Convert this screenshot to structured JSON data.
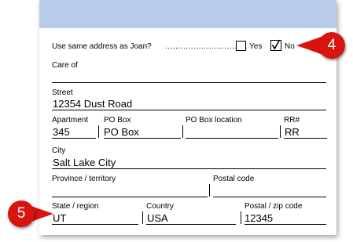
{
  "question": "Use same address as Joan?",
  "leader_dots": "................................",
  "options": {
    "yes_label": "Yes",
    "no_label": "No",
    "selected": "No"
  },
  "fields": {
    "care_of": {
      "label": "Care of",
      "value": ""
    },
    "street": {
      "label": "Street",
      "value": "12354 Dust Road"
    },
    "apartment": {
      "label": "Apartment",
      "value": "345"
    },
    "po_box": {
      "label": "PO Box",
      "value": "PO Box"
    },
    "po_box_location": {
      "label": "PO Box location",
      "value": ""
    },
    "rr": {
      "label": "RR#",
      "value": "RR"
    },
    "city": {
      "label": "City",
      "value": "Salt Lake City"
    },
    "province": {
      "label": "Province / territory",
      "value": ""
    },
    "postal_code": {
      "label": "Postal code",
      "value": ""
    },
    "state": {
      "label": "State / region",
      "value": "UT"
    },
    "country": {
      "label": "Country",
      "value": "USA"
    },
    "zip": {
      "label": "Postal / zip code",
      "value": "12345"
    }
  },
  "callouts": {
    "badge_4": "4",
    "badge_5": "5"
  },
  "colors": {
    "header_band": "#b9cdea",
    "badge": "#d9140f"
  }
}
